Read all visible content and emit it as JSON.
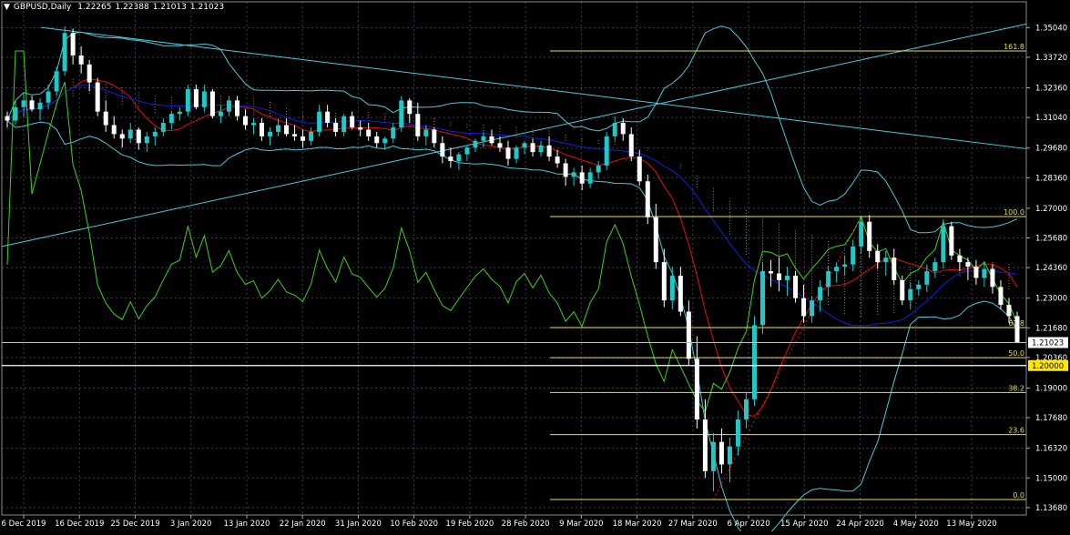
{
  "header": {
    "symbol": "GBPUSD,Daily",
    "open": "1.22265",
    "high": "1.22388",
    "low": "1.21013",
    "close": "1.21023"
  },
  "colors": {
    "background": "#000000",
    "grid": "#3a3f48",
    "text": "#ffffff",
    "bull_candle": "#20c8c8",
    "bear_candle": "#ffffff",
    "fib": "#e8e050",
    "trendline": "#4fc8d8",
    "bollinger": "#4fc8d8",
    "ma_red": "#e01010",
    "ma_blue": "#1020e0",
    "rsi_green": "#40d020",
    "cloud": "#e8a070",
    "price_tag_bg": "#ffffff",
    "yellow_tag_bg": "#ffe800"
  },
  "chart_data": {
    "type": "candlestick",
    "y_ticks": [
      "1.35040",
      "1.33720",
      "1.32360",
      "1.31040",
      "1.29680",
      "1.28360",
      "1.27000",
      "1.25680",
      "1.24360",
      "1.23000",
      "1.21680",
      "1.20360",
      "1.19000",
      "1.17680",
      "1.16320",
      "1.15000",
      "1.13680"
    ],
    "x_ticks": [
      "6 Dec 2019",
      "16 Dec 2019",
      "25 Dec 2019",
      "3 Jan 2020",
      "13 Jan 2020",
      "22 Jan 2020",
      "31 Jan 2020",
      "10 Feb 2020",
      "19 Feb 2020",
      "28 Feb 2020",
      "9 Mar 2020",
      "18 Mar 2020",
      "27 Mar 2020",
      "6 Apr 2020",
      "15 Apr 2020",
      "24 Apr 2020",
      "4 May 2020",
      "13 May 2020"
    ],
    "ylim": [
      1.1335,
      1.3562
    ],
    "current_price": "1.21023",
    "level_tag": "1.20000",
    "fib_levels": [
      {
        "label": "161.8",
        "price": 1.34
      },
      {
        "label": "100.0",
        "price": 1.2663
      },
      {
        "label": "61.8",
        "price": 1.2169
      },
      {
        "label": "50.0",
        "price": 1.2035
      },
      {
        "label": "38.2",
        "price": 1.188
      },
      {
        "label": "23.6",
        "price": 1.1693
      },
      {
        "label": "0.0",
        "price": 1.1404
      }
    ],
    "candles_ohlc": [
      [
        1.311,
        1.313,
        1.306,
        1.309
      ],
      [
        1.309,
        1.318,
        1.307,
        1.315
      ],
      [
        1.315,
        1.321,
        1.311,
        1.318
      ],
      [
        1.318,
        1.32,
        1.313,
        1.314
      ],
      [
        1.314,
        1.319,
        1.309,
        1.317
      ],
      [
        1.317,
        1.325,
        1.314,
        1.322
      ],
      [
        1.322,
        1.333,
        1.32,
        1.331
      ],
      [
        1.331,
        1.351,
        1.329,
        1.348
      ],
      [
        1.348,
        1.35,
        1.334,
        1.338
      ],
      [
        1.338,
        1.342,
        1.33,
        1.334
      ],
      [
        1.334,
        1.336,
        1.322,
        1.326
      ],
      [
        1.326,
        1.328,
        1.311,
        1.313
      ],
      [
        1.313,
        1.318,
        1.304,
        1.307
      ],
      [
        1.307,
        1.311,
        1.301,
        1.303
      ],
      [
        1.303,
        1.305,
        1.297,
        1.301
      ],
      [
        1.301,
        1.308,
        1.299,
        1.305
      ],
      [
        1.305,
        1.306,
        1.296,
        1.299
      ],
      [
        1.299,
        1.304,
        1.295,
        1.302
      ],
      [
        1.302,
        1.306,
        1.298,
        1.304
      ],
      [
        1.304,
        1.31,
        1.302,
        1.308
      ],
      [
        1.308,
        1.313,
        1.305,
        1.312
      ],
      [
        1.312,
        1.315,
        1.309,
        1.313
      ],
      [
        1.313,
        1.325,
        1.311,
        1.323
      ],
      [
        1.323,
        1.325,
        1.314,
        1.315
      ],
      [
        1.315,
        1.325,
        1.313,
        1.322
      ],
      [
        1.322,
        1.323,
        1.31,
        1.311
      ],
      [
        1.311,
        1.316,
        1.308,
        1.313
      ],
      [
        1.313,
        1.32,
        1.311,
        1.318
      ],
      [
        1.318,
        1.32,
        1.309,
        1.311
      ],
      [
        1.311,
        1.314,
        1.305,
        1.307
      ],
      [
        1.307,
        1.31,
        1.303,
        1.308
      ],
      [
        1.308,
        1.31,
        1.3,
        1.302
      ],
      [
        1.302,
        1.306,
        1.298,
        1.304
      ],
      [
        1.304,
        1.31,
        1.302,
        1.307
      ],
      [
        1.307,
        1.31,
        1.302,
        1.303
      ],
      [
        1.303,
        1.307,
        1.3,
        1.302
      ],
      [
        1.302,
        1.305,
        1.297,
        1.3
      ],
      [
        1.3,
        1.306,
        1.298,
        1.304
      ],
      [
        1.304,
        1.316,
        1.302,
        1.313
      ],
      [
        1.313,
        1.316,
        1.306,
        1.308
      ],
      [
        1.308,
        1.31,
        1.302,
        1.304
      ],
      [
        1.304,
        1.312,
        1.302,
        1.311
      ],
      [
        1.311,
        1.313,
        1.305,
        1.306
      ],
      [
        1.306,
        1.309,
        1.302,
        1.305
      ],
      [
        1.305,
        1.308,
        1.3,
        1.302
      ],
      [
        1.302,
        1.304,
        1.297,
        1.299
      ],
      [
        1.299,
        1.302,
        1.296,
        1.301
      ],
      [
        1.301,
        1.308,
        1.299,
        1.306
      ],
      [
        1.306,
        1.32,
        1.304,
        1.318
      ],
      [
        1.318,
        1.319,
        1.308,
        1.312
      ],
      [
        1.312,
        1.317,
        1.3,
        1.302
      ],
      [
        1.302,
        1.307,
        1.298,
        1.305
      ],
      [
        1.305,
        1.306,
        1.297,
        1.299
      ],
      [
        1.299,
        1.302,
        1.29,
        1.293
      ],
      [
        1.293,
        1.297,
        1.288,
        1.291
      ],
      [
        1.291,
        1.295,
        1.287,
        1.294
      ],
      [
        1.294,
        1.298,
        1.291,
        1.297
      ],
      [
        1.297,
        1.301,
        1.295,
        1.3
      ],
      [
        1.3,
        1.304,
        1.297,
        1.302
      ],
      [
        1.302,
        1.305,
        1.298,
        1.299
      ],
      [
        1.299,
        1.302,
        1.295,
        1.297
      ],
      [
        1.297,
        1.3,
        1.289,
        1.292
      ],
      [
        1.292,
        1.298,
        1.29,
        1.297
      ],
      [
        1.297,
        1.3,
        1.294,
        1.299
      ],
      [
        1.299,
        1.301,
        1.293,
        1.295
      ],
      [
        1.295,
        1.3,
        1.293,
        1.298
      ],
      [
        1.298,
        1.302,
        1.291,
        1.293
      ],
      [
        1.293,
        1.296,
        1.288,
        1.29
      ],
      [
        1.29,
        1.292,
        1.28,
        1.284
      ],
      [
        1.284,
        1.288,
        1.28,
        1.286
      ],
      [
        1.286,
        1.289,
        1.278,
        1.281
      ],
      [
        1.281,
        1.288,
        1.279,
        1.286
      ],
      [
        1.286,
        1.291,
        1.283,
        1.289
      ],
      [
        1.289,
        1.304,
        1.287,
        1.302
      ],
      [
        1.302,
        1.311,
        1.3,
        1.308
      ],
      [
        1.308,
        1.31,
        1.3,
        1.303
      ],
      [
        1.303,
        1.306,
        1.291,
        1.293
      ],
      [
        1.293,
        1.296,
        1.28,
        1.282
      ],
      [
        1.282,
        1.285,
        1.263,
        1.266
      ],
      [
        1.266,
        1.272,
        1.243,
        1.246
      ],
      [
        1.246,
        1.252,
        1.226,
        1.229
      ],
      [
        1.229,
        1.244,
        1.225,
        1.24
      ],
      [
        1.24,
        1.244,
        1.222,
        1.224
      ],
      [
        1.224,
        1.229,
        1.2,
        1.203
      ],
      [
        1.203,
        1.213,
        1.172,
        1.176
      ],
      [
        1.176,
        1.185,
        1.15,
        1.153
      ],
      [
        1.153,
        1.17,
        1.144,
        1.166
      ],
      [
        1.166,
        1.172,
        1.152,
        1.156
      ],
      [
        1.156,
        1.168,
        1.148,
        1.164
      ],
      [
        1.164,
        1.18,
        1.16,
        1.176
      ],
      [
        1.176,
        1.188,
        1.172,
        1.185
      ],
      [
        1.185,
        1.222,
        1.182,
        1.218
      ],
      [
        1.218,
        1.246,
        1.214,
        1.242
      ],
      [
        1.242,
        1.247,
        1.235,
        1.241
      ],
      [
        1.241,
        1.248,
        1.233,
        1.238
      ],
      [
        1.238,
        1.244,
        1.231,
        1.24
      ],
      [
        1.24,
        1.242,
        1.228,
        1.23
      ],
      [
        1.23,
        1.236,
        1.219,
        1.222
      ],
      [
        1.222,
        1.231,
        1.219,
        1.229
      ],
      [
        1.229,
        1.238,
        1.224,
        1.235
      ],
      [
        1.235,
        1.244,
        1.231,
        1.242
      ],
      [
        1.242,
        1.246,
        1.237,
        1.244
      ],
      [
        1.244,
        1.249,
        1.24,
        1.245
      ],
      [
        1.245,
        1.256,
        1.242,
        1.253
      ],
      [
        1.253,
        1.266,
        1.25,
        1.264
      ],
      [
        1.264,
        1.267,
        1.248,
        1.251
      ],
      [
        1.251,
        1.254,
        1.243,
        1.246
      ],
      [
        1.246,
        1.251,
        1.24,
        1.248
      ],
      [
        1.248,
        1.252,
        1.236,
        1.238
      ],
      [
        1.238,
        1.24,
        1.227,
        1.229
      ],
      [
        1.229,
        1.237,
        1.225,
        1.234
      ],
      [
        1.234,
        1.238,
        1.231,
        1.236
      ],
      [
        1.236,
        1.245,
        1.233,
        1.242
      ],
      [
        1.242,
        1.248,
        1.239,
        1.246
      ],
      [
        1.246,
        1.265,
        1.243,
        1.262
      ],
      [
        1.262,
        1.264,
        1.247,
        1.249
      ],
      [
        1.249,
        1.252,
        1.242,
        1.246
      ],
      [
        1.246,
        1.248,
        1.238,
        1.244
      ],
      [
        1.244,
        1.247,
        1.236,
        1.239
      ],
      [
        1.239,
        1.246,
        1.235,
        1.243
      ],
      [
        1.243,
        1.245,
        1.232,
        1.235
      ],
      [
        1.235,
        1.238,
        1.225,
        1.227
      ],
      [
        1.227,
        1.23,
        1.219,
        1.222
      ],
      [
        1.222,
        1.224,
        1.21,
        1.21
      ]
    ]
  }
}
